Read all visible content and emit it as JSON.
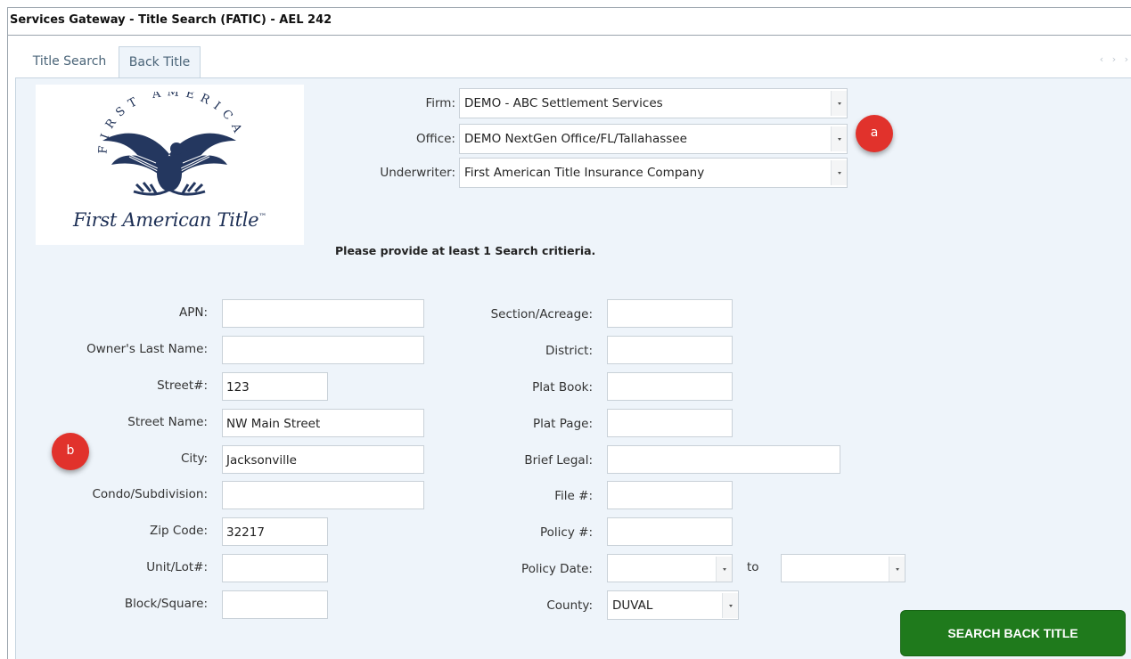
{
  "window": {
    "title": "Services Gateway - Title Search (FATIC) - AEL 242"
  },
  "tabs": [
    {
      "label": "Title Search"
    },
    {
      "label": "Back Title"
    }
  ],
  "logo": {
    "arc_text": "FIRST AMERICAN",
    "name": "First American Title",
    "tm": "™"
  },
  "header_fields": {
    "firm": {
      "label": "Firm:",
      "value": "DEMO - ABC Settlement Services"
    },
    "office": {
      "label": "Office:",
      "value": "DEMO NextGen Office/FL/Tallahassee"
    },
    "underwriter": {
      "label": "Underwriter:",
      "value": "First American Title Insurance Company"
    }
  },
  "notice": "Please provide at least 1 Search critieria.",
  "left_fields": {
    "apn": {
      "label": "APN:",
      "value": ""
    },
    "owner_last_name": {
      "label": "Owner's Last Name:",
      "value": ""
    },
    "street_no": {
      "label": "Street#:",
      "value": "123"
    },
    "street_name": {
      "label": "Street Name:",
      "value": "NW Main Street"
    },
    "city": {
      "label": "City:",
      "value": "Jacksonville"
    },
    "condo": {
      "label": "Condo/Subdivision:",
      "value": ""
    },
    "zip": {
      "label": "Zip Code:",
      "value": "32217"
    },
    "unit_lot": {
      "label": "Unit/Lot#:",
      "value": ""
    },
    "block_square": {
      "label": "Block/Square:",
      "value": ""
    }
  },
  "right_fields": {
    "section_acreage": {
      "label": "Section/Acreage:",
      "value": ""
    },
    "district": {
      "label": "District:",
      "value": ""
    },
    "plat_book": {
      "label": "Plat Book:",
      "value": ""
    },
    "plat_page": {
      "label": "Plat Page:",
      "value": ""
    },
    "brief_legal": {
      "label": "Brief Legal:",
      "value": ""
    },
    "file_no": {
      "label": "File #:",
      "value": ""
    },
    "policy_no": {
      "label": "Policy #:",
      "value": ""
    },
    "policy_date": {
      "label": "Policy Date:",
      "from": "",
      "to_label": "to",
      "to": ""
    },
    "county": {
      "label": "County:",
      "value": "DUVAL"
    }
  },
  "callouts": {
    "a": "a",
    "b": "b"
  },
  "search_button": "SEARCH BACK TITLE",
  "colors": {
    "accent_button": "#1f7a1c",
    "callout": "#e1322c",
    "panel": "#eef4fa",
    "tab_text": "#4a6478"
  }
}
